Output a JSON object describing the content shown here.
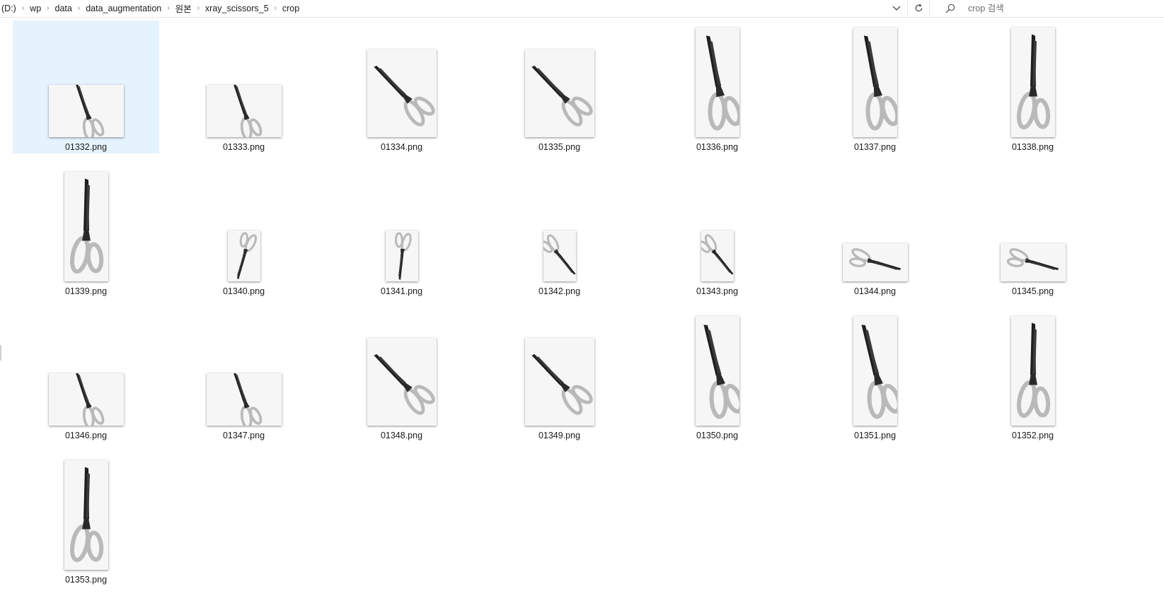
{
  "address": {
    "crumbs": [
      "(D:)",
      "wp",
      "data",
      "data_augmentation",
      "원본",
      "xray_scissors_5",
      "crop"
    ],
    "separator_icon": "chevron-right-icon",
    "dropdown_icon": "chevron-down-icon",
    "refresh_icon": "refresh-icon"
  },
  "search": {
    "placeholder": "crop 검색",
    "icon": "search-icon"
  },
  "files": [
    {
      "name": "01332.png",
      "shape": "wide",
      "angle": -20,
      "selected": true
    },
    {
      "name": "01333.png",
      "shape": "wide",
      "angle": -20,
      "selected": false
    },
    {
      "name": "01334.png",
      "shape": "square",
      "angle": -45,
      "selected": false
    },
    {
      "name": "01335.png",
      "shape": "square",
      "angle": -45,
      "selected": false
    },
    {
      "name": "01336.png",
      "shape": "tall",
      "angle": -12,
      "selected": false
    },
    {
      "name": "01337.png",
      "shape": "tall",
      "angle": -12,
      "selected": false
    },
    {
      "name": "01338.png",
      "shape": "tall",
      "angle": 0,
      "selected": false
    },
    {
      "name": "01339.png",
      "shape": "tall",
      "angle": 0,
      "selected": false
    },
    {
      "name": "01340.png",
      "shape": "small",
      "angle": 195,
      "selected": false
    },
    {
      "name": "01341.png",
      "shape": "small",
      "angle": 185,
      "selected": false
    },
    {
      "name": "01342.png",
      "shape": "small",
      "angle": 140,
      "selected": false
    },
    {
      "name": "01343.png",
      "shape": "small",
      "angle": 140,
      "selected": false
    },
    {
      "name": "01344.png",
      "shape": "flat",
      "angle": 105,
      "selected": false
    },
    {
      "name": "01345.png",
      "shape": "flat",
      "angle": 105,
      "selected": false
    },
    {
      "name": "01346.png",
      "shape": "wide",
      "angle": -20,
      "selected": false
    },
    {
      "name": "01347.png",
      "shape": "wide",
      "angle": -20,
      "selected": false
    },
    {
      "name": "01348.png",
      "shape": "square",
      "angle": -45,
      "selected": false
    },
    {
      "name": "01349.png",
      "shape": "square",
      "angle": -45,
      "selected": false
    },
    {
      "name": "01350.png",
      "shape": "tall",
      "angle": -15,
      "selected": false
    },
    {
      "name": "01351.png",
      "shape": "tall",
      "angle": -15,
      "selected": false
    },
    {
      "name": "01352.png",
      "shape": "tall",
      "angle": 0,
      "selected": false
    },
    {
      "name": "01353.png",
      "shape": "tall",
      "angle": 0,
      "selected": false
    }
  ],
  "colors": {
    "selection": "#e5f3ff",
    "blade": "#1e1e1e",
    "handle": "#b9b9b9"
  }
}
